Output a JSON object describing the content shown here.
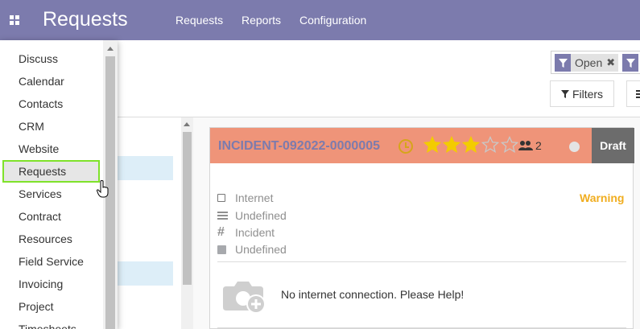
{
  "topbar": {
    "app_title": "Requests",
    "nav": [
      "Requests",
      "Reports",
      "Configuration"
    ],
    "color": "#7c7bad"
  },
  "search": {
    "facets": [
      {
        "label": "Open",
        "close": "✖"
      }
    ]
  },
  "buttons": {
    "filters": "Filters"
  },
  "card": {
    "title": "INCIDENT-092022-0000005",
    "rating": 3,
    "rating_max": 5,
    "followers": "2",
    "stage": "Draft",
    "header_color": "#ef9479",
    "fields": [
      {
        "icon": "checkbox-icon",
        "value": "Internet"
      },
      {
        "icon": "list-icon",
        "value": "Undefined"
      },
      {
        "icon": "hash-icon",
        "value": "Incident"
      },
      {
        "icon": "square-icon",
        "value": "Undefined"
      }
    ],
    "priority_label": "Warning",
    "description": "No internet connection. Please Help!"
  },
  "app_menu": {
    "items": [
      "Discuss",
      "Calendar",
      "Contacts",
      "CRM",
      "Website",
      "Requests",
      "Services",
      "Contract",
      "Resources",
      "Field Service",
      "Invoicing",
      "Project",
      "Timesheets"
    ],
    "active": "Requests",
    "highlight_color": "#7fe22a"
  }
}
